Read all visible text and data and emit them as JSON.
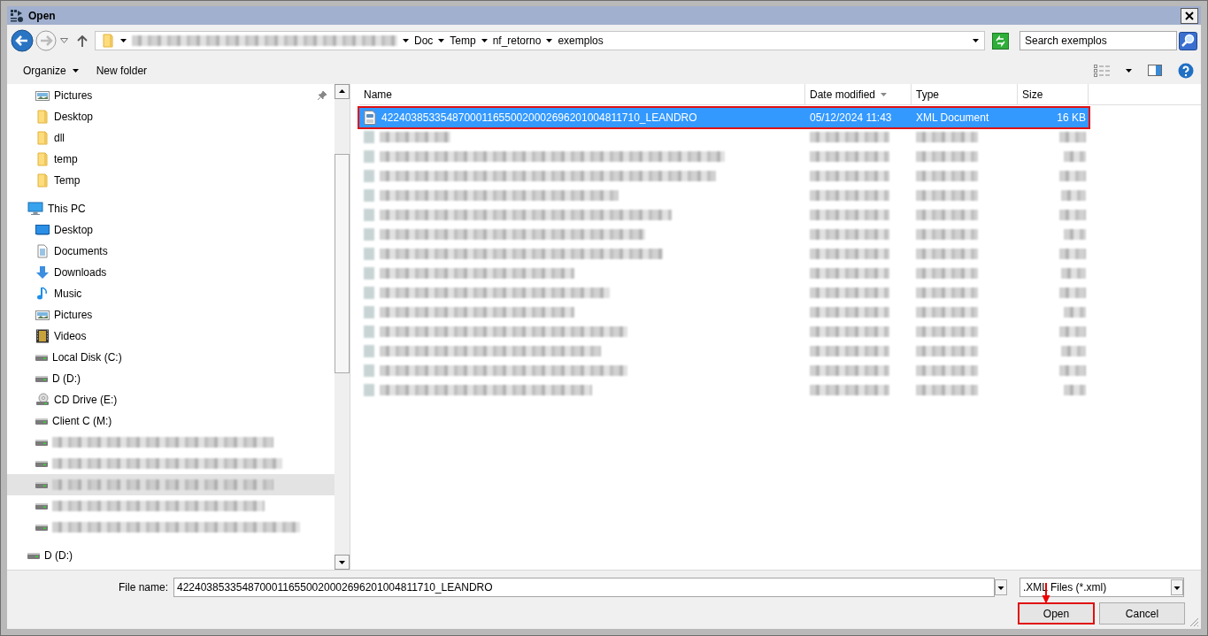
{
  "window": {
    "title": "Open"
  },
  "address_bar": {
    "crumbs": [
      "Doc",
      "Temp",
      "nf_retorno",
      "exemplos"
    ]
  },
  "search": {
    "placeholder": "Search exemplos"
  },
  "toolbar": {
    "buttons": [
      {
        "label": "Organize",
        "kind": "menu"
      },
      {
        "label": "New folder",
        "kind": "plain"
      }
    ]
  },
  "sidebar": {
    "items": [
      {
        "label": "Pictures",
        "kind": "pictures",
        "pinned": true
      },
      {
        "label": "Desktop",
        "kind": "folder"
      },
      {
        "label": "dll",
        "kind": "folder"
      },
      {
        "label": "temp",
        "kind": "folder"
      },
      {
        "label": "Temp",
        "kind": "folder"
      },
      {
        "label": "This PC",
        "kind": "pc",
        "children": [
          {
            "label": "Desktop",
            "kind": "desktop"
          },
          {
            "label": "Documents",
            "kind": "documents"
          },
          {
            "label": "Downloads",
            "kind": "downloads"
          },
          {
            "label": "Music",
            "kind": "music"
          },
          {
            "label": "Pictures",
            "kind": "pictures"
          },
          {
            "label": "Videos",
            "kind": "videos"
          },
          {
            "label": "Local Disk (C:)",
            "kind": "drive"
          },
          {
            "label": "D (D:)",
            "kind": "drive"
          },
          {
            "label": "CD Drive (E:)",
            "kind": "cd"
          },
          {
            "label": "Client C (M:)",
            "kind": "drive"
          },
          {
            "kind": "drive"
          },
          {
            "kind": "drive"
          },
          {
            "kind": "drive",
            "hovered": true
          },
          {
            "kind": "drive"
          },
          {
            "kind": "drive"
          }
        ]
      },
      {
        "label": "D (D:)",
        "kind": "drive"
      }
    ]
  },
  "file_list": {
    "columns": [
      {
        "label": "Name",
        "sorted": false
      },
      {
        "label": "Date modified",
        "sorted": true
      },
      {
        "label": "Type",
        "sorted": false
      },
      {
        "label": "Size",
        "sorted": false
      }
    ],
    "rows": [
      {
        "kind": "file",
        "name": "42240385335487000116550020002696201004811710_LEANDRO",
        "date": "05/12/2024 11:43",
        "type": "XML Document",
        "size": "16 KB",
        "selected": true,
        "annotated": true
      },
      {
        "kind": "redacted",
        "selected": false,
        "annotated": false
      },
      {
        "kind": "redacted",
        "selected": false,
        "annotated": false
      },
      {
        "kind": "redacted",
        "selected": false,
        "annotated": false
      },
      {
        "kind": "redacted",
        "selected": false,
        "annotated": false
      },
      {
        "kind": "redacted",
        "selected": false,
        "annotated": false
      },
      {
        "kind": "redacted",
        "selected": false,
        "annotated": false
      },
      {
        "kind": "redacted",
        "selected": false,
        "annotated": false
      },
      {
        "kind": "redacted",
        "selected": false,
        "annotated": false
      },
      {
        "kind": "redacted",
        "selected": false,
        "annotated": false
      },
      {
        "kind": "redacted",
        "selected": false,
        "annotated": false
      },
      {
        "kind": "redacted",
        "selected": false,
        "annotated": false
      },
      {
        "kind": "redacted",
        "selected": false,
        "annotated": false
      },
      {
        "kind": "redacted",
        "selected": false,
        "annotated": false
      },
      {
        "kind": "redacted",
        "selected": false,
        "annotated": false
      }
    ]
  },
  "file_name": {
    "label": "File name:",
    "value": "42240385335487000116550020002696201004811710_LEANDRO"
  },
  "file_type": {
    "value": ".XML Files (*.xml)"
  },
  "buttons": [
    {
      "label": "Open",
      "annotated": true
    },
    {
      "label": "Cancel",
      "annotated": false
    }
  ],
  "annotation_arrow": true
}
